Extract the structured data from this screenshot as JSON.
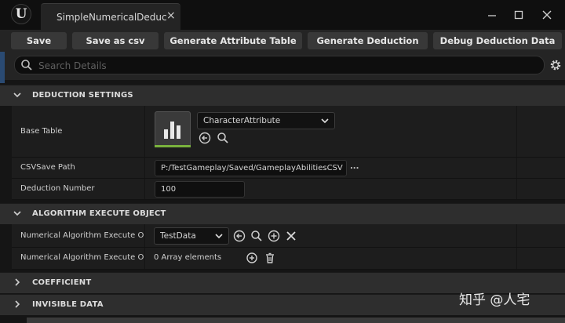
{
  "window": {
    "tab_title": "SimpleNumericalDeduction",
    "close_tab": "×"
  },
  "toolbar": {
    "save": "Save",
    "save_csv": "Save as csv",
    "gen_attr_table": "Generate Attribute Table",
    "gen_deduction": "Generate Deduction",
    "debug_data": "Debug Deduction Data"
  },
  "search": {
    "placeholder": "Search Details"
  },
  "sections": {
    "deduction": "DEDUCTION SETTINGS",
    "algorithm": "ALGORITHM EXECUTE OBJECT",
    "coefficient": "COEFFICIENT",
    "invisible": "INVISIBLE DATA"
  },
  "deduction": {
    "base_table_label": "Base Table",
    "base_table_value": "CharacterAttribute",
    "csv_path_label": "CSVSave Path",
    "csv_path_value": "P:/TestGameplay/Saved/GameplayAbilitiesCSV",
    "csv_browse": "...",
    "number_label": "Deduction Number",
    "number_value": "100"
  },
  "algorithm": {
    "row1_label": "Numerical Algorithm Execute Obje",
    "row1_value": "TestData",
    "row2_label": "Numerical Algorithm Execute Obje",
    "row2_value": "0 Array elements"
  },
  "watermark": "知乎 @人宅",
  "icons": [
    "unreal-logo",
    "close-icon",
    "minimize-icon",
    "maximize-icon",
    "search-icon",
    "gear-icon",
    "chevron-down-icon",
    "chevron-right-icon",
    "bar-chart-icon",
    "back-arrow-icon",
    "search-icon",
    "add-icon",
    "clear-icon",
    "trash-icon"
  ]
}
